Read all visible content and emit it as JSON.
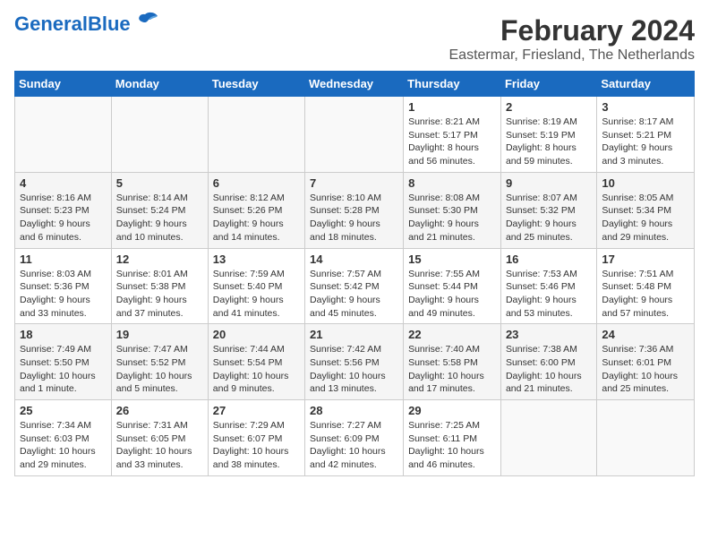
{
  "header": {
    "logo_main": "General",
    "logo_sub": "Blue",
    "month_year": "February 2024",
    "location": "Eastermar, Friesland, The Netherlands"
  },
  "days_of_week": [
    "Sunday",
    "Monday",
    "Tuesday",
    "Wednesday",
    "Thursday",
    "Friday",
    "Saturday"
  ],
  "weeks": [
    [
      {
        "num": "",
        "info": ""
      },
      {
        "num": "",
        "info": ""
      },
      {
        "num": "",
        "info": ""
      },
      {
        "num": "",
        "info": ""
      },
      {
        "num": "1",
        "info": "Sunrise: 8:21 AM\nSunset: 5:17 PM\nDaylight: 8 hours\nand 56 minutes."
      },
      {
        "num": "2",
        "info": "Sunrise: 8:19 AM\nSunset: 5:19 PM\nDaylight: 8 hours\nand 59 minutes."
      },
      {
        "num": "3",
        "info": "Sunrise: 8:17 AM\nSunset: 5:21 PM\nDaylight: 9 hours\nand 3 minutes."
      }
    ],
    [
      {
        "num": "4",
        "info": "Sunrise: 8:16 AM\nSunset: 5:23 PM\nDaylight: 9 hours\nand 6 minutes."
      },
      {
        "num": "5",
        "info": "Sunrise: 8:14 AM\nSunset: 5:24 PM\nDaylight: 9 hours\nand 10 minutes."
      },
      {
        "num": "6",
        "info": "Sunrise: 8:12 AM\nSunset: 5:26 PM\nDaylight: 9 hours\nand 14 minutes."
      },
      {
        "num": "7",
        "info": "Sunrise: 8:10 AM\nSunset: 5:28 PM\nDaylight: 9 hours\nand 18 minutes."
      },
      {
        "num": "8",
        "info": "Sunrise: 8:08 AM\nSunset: 5:30 PM\nDaylight: 9 hours\nand 21 minutes."
      },
      {
        "num": "9",
        "info": "Sunrise: 8:07 AM\nSunset: 5:32 PM\nDaylight: 9 hours\nand 25 minutes."
      },
      {
        "num": "10",
        "info": "Sunrise: 8:05 AM\nSunset: 5:34 PM\nDaylight: 9 hours\nand 29 minutes."
      }
    ],
    [
      {
        "num": "11",
        "info": "Sunrise: 8:03 AM\nSunset: 5:36 PM\nDaylight: 9 hours\nand 33 minutes."
      },
      {
        "num": "12",
        "info": "Sunrise: 8:01 AM\nSunset: 5:38 PM\nDaylight: 9 hours\nand 37 minutes."
      },
      {
        "num": "13",
        "info": "Sunrise: 7:59 AM\nSunset: 5:40 PM\nDaylight: 9 hours\nand 41 minutes."
      },
      {
        "num": "14",
        "info": "Sunrise: 7:57 AM\nSunset: 5:42 PM\nDaylight: 9 hours\nand 45 minutes."
      },
      {
        "num": "15",
        "info": "Sunrise: 7:55 AM\nSunset: 5:44 PM\nDaylight: 9 hours\nand 49 minutes."
      },
      {
        "num": "16",
        "info": "Sunrise: 7:53 AM\nSunset: 5:46 PM\nDaylight: 9 hours\nand 53 minutes."
      },
      {
        "num": "17",
        "info": "Sunrise: 7:51 AM\nSunset: 5:48 PM\nDaylight: 9 hours\nand 57 minutes."
      }
    ],
    [
      {
        "num": "18",
        "info": "Sunrise: 7:49 AM\nSunset: 5:50 PM\nDaylight: 10 hours\nand 1 minute."
      },
      {
        "num": "19",
        "info": "Sunrise: 7:47 AM\nSunset: 5:52 PM\nDaylight: 10 hours\nand 5 minutes."
      },
      {
        "num": "20",
        "info": "Sunrise: 7:44 AM\nSunset: 5:54 PM\nDaylight: 10 hours\nand 9 minutes."
      },
      {
        "num": "21",
        "info": "Sunrise: 7:42 AM\nSunset: 5:56 PM\nDaylight: 10 hours\nand 13 minutes."
      },
      {
        "num": "22",
        "info": "Sunrise: 7:40 AM\nSunset: 5:58 PM\nDaylight: 10 hours\nand 17 minutes."
      },
      {
        "num": "23",
        "info": "Sunrise: 7:38 AM\nSunset: 6:00 PM\nDaylight: 10 hours\nand 21 minutes."
      },
      {
        "num": "24",
        "info": "Sunrise: 7:36 AM\nSunset: 6:01 PM\nDaylight: 10 hours\nand 25 minutes."
      }
    ],
    [
      {
        "num": "25",
        "info": "Sunrise: 7:34 AM\nSunset: 6:03 PM\nDaylight: 10 hours\nand 29 minutes."
      },
      {
        "num": "26",
        "info": "Sunrise: 7:31 AM\nSunset: 6:05 PM\nDaylight: 10 hours\nand 33 minutes."
      },
      {
        "num": "27",
        "info": "Sunrise: 7:29 AM\nSunset: 6:07 PM\nDaylight: 10 hours\nand 38 minutes."
      },
      {
        "num": "28",
        "info": "Sunrise: 7:27 AM\nSunset: 6:09 PM\nDaylight: 10 hours\nand 42 minutes."
      },
      {
        "num": "29",
        "info": "Sunrise: 7:25 AM\nSunset: 6:11 PM\nDaylight: 10 hours\nand 46 minutes."
      },
      {
        "num": "",
        "info": ""
      },
      {
        "num": "",
        "info": ""
      }
    ]
  ]
}
